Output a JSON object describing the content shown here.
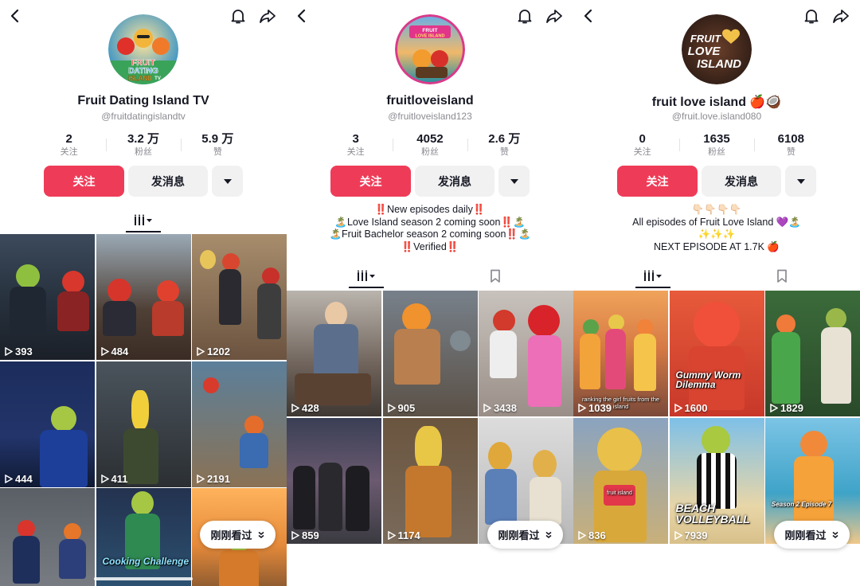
{
  "panels": [
    {
      "name": "Fruit Dating Island TV",
      "handle": "@fruitdatingislandtv",
      "avatar_text": [
        "FRUIT",
        "DATING",
        "ISLAND",
        "TV"
      ],
      "stats": [
        {
          "value": "2",
          "label": "关注"
        },
        {
          "value": "3.2 万",
          "label": "粉丝"
        },
        {
          "value": "5.9 万",
          "label": "赞"
        }
      ],
      "follow_label": "关注",
      "message_label": "发消息",
      "bio": [],
      "videos": [
        {
          "views": "393",
          "caption": ""
        },
        {
          "views": "484",
          "caption": ""
        },
        {
          "views": "1202",
          "caption": ""
        },
        {
          "views": "444",
          "caption": ""
        },
        {
          "views": "411",
          "caption": ""
        },
        {
          "views": "2191",
          "caption": ""
        },
        {
          "views": "",
          "caption": ""
        },
        {
          "views": "",
          "caption": "Cooking Challenge"
        },
        {
          "views": "",
          "caption": ""
        }
      ],
      "recent_label": "刚刚看过"
    },
    {
      "name": "fruitloveisland",
      "handle": "@fruitloveisland123",
      "avatar_text": [
        "FRUIT",
        "LOVE ISLAND"
      ],
      "stats": [
        {
          "value": "3",
          "label": "关注"
        },
        {
          "value": "4052",
          "label": "粉丝"
        },
        {
          "value": "2.6 万",
          "label": "赞"
        }
      ],
      "follow_label": "关注",
      "message_label": "发消息",
      "bio": [
        "‼️New episodes daily‼️",
        "🏝️Love Island season 2 coming soon‼️🏝️",
        "🏝️Fruit Bachelor season 2 coming soon‼️🏝️",
        "‼️Verified‼️"
      ],
      "videos": [
        {
          "views": "428",
          "caption": ""
        },
        {
          "views": "905",
          "caption": ""
        },
        {
          "views": "3438",
          "caption": ""
        },
        {
          "views": "859",
          "caption": ""
        },
        {
          "views": "1174",
          "caption": ""
        },
        {
          "views": "",
          "caption": ""
        }
      ],
      "recent_label": "刚刚看过"
    },
    {
      "name": "fruit love island 🍎🥥",
      "handle": "@fruit.love.island080",
      "avatar_text": [
        "FRUIT",
        "LOVE",
        "ISLAND"
      ],
      "stats": [
        {
          "value": "0",
          "label": "关注"
        },
        {
          "value": "1635",
          "label": "粉丝"
        },
        {
          "value": "6108",
          "label": "赞"
        }
      ],
      "follow_label": "关注",
      "message_label": "发消息",
      "bio": [
        "👇🏻👇🏻👇🏻👇🏻",
        "All episodes of Fruit Love Island 💜🏝️",
        "✨✨✨",
        "NEXT EPISODE AT 1.7K 🍎"
      ],
      "videos": [
        {
          "views": "1039",
          "caption": "ranking the girl fruits from the island"
        },
        {
          "views": "1600",
          "caption": "Gummy Worm Dilemma"
        },
        {
          "views": "1829",
          "caption": ""
        },
        {
          "views": "836",
          "caption": "fruit island"
        },
        {
          "views": "7939",
          "caption": "BEACH VOLLEYBALL"
        },
        {
          "views": "",
          "caption": "Season 2 Episode 7"
        }
      ],
      "recent_label": "刚刚看过"
    }
  ],
  "colors": {
    "follow_button": "#ee3c58",
    "secondary_button": "#f1f1f2",
    "muted_text": "#8a8b91"
  },
  "icons": [
    "back-arrow-icon",
    "bell-icon",
    "share-icon",
    "dropdown-caret-icon",
    "grid-videos-icon",
    "bookmark-icon",
    "play-icon",
    "chevron-double-down-icon"
  ]
}
